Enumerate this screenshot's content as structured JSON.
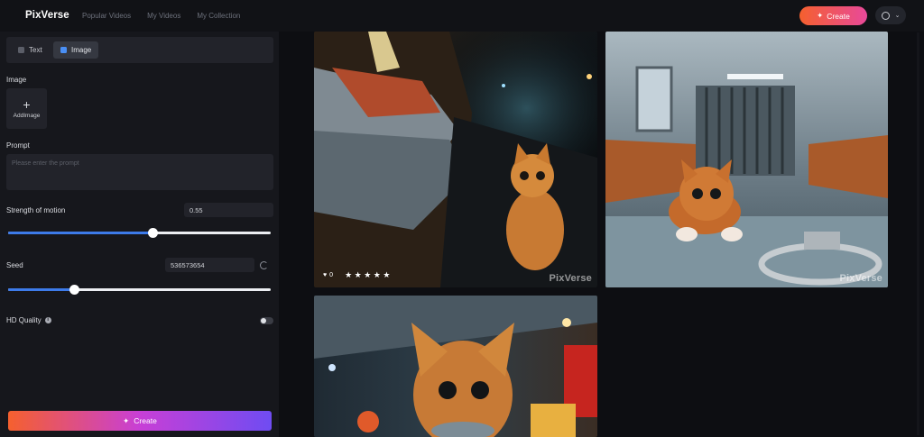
{
  "header": {
    "logo": "PixVerse",
    "nav": [
      "Popular Videos",
      "My Videos",
      "My Collection"
    ],
    "create_label": "Create"
  },
  "sidebar": {
    "tabs": [
      {
        "label": "Text",
        "active": false
      },
      {
        "label": "Image",
        "active": true
      }
    ],
    "image_label": "Image",
    "add_image_label": "AddImage",
    "prompt_label": "Prompt",
    "prompt_placeholder": "Please enter the prompt",
    "motion_label": "Strength of motion",
    "motion_value": "0.55",
    "motion_fraction": 0.55,
    "seed_label": "Seed",
    "seed_value": "536573654",
    "seed_fraction": 0.25,
    "hd_label": "HD Quality",
    "hd_enabled": false,
    "create_label": "Create"
  },
  "gallery": {
    "watermark": "PixVerse",
    "cards": [
      {
        "scene": "kitten-fish-market-night",
        "likes": "0",
        "stars": "★★★★★"
      },
      {
        "scene": "kitten-police-station-handcuffs"
      },
      {
        "scene": "kitten-eating-fish-market"
      }
    ]
  },
  "colors": {
    "accent_blue": "#3d7bea",
    "create_gradient_start": "#f5602e",
    "create_gradient_end": "#6f4cf2"
  }
}
